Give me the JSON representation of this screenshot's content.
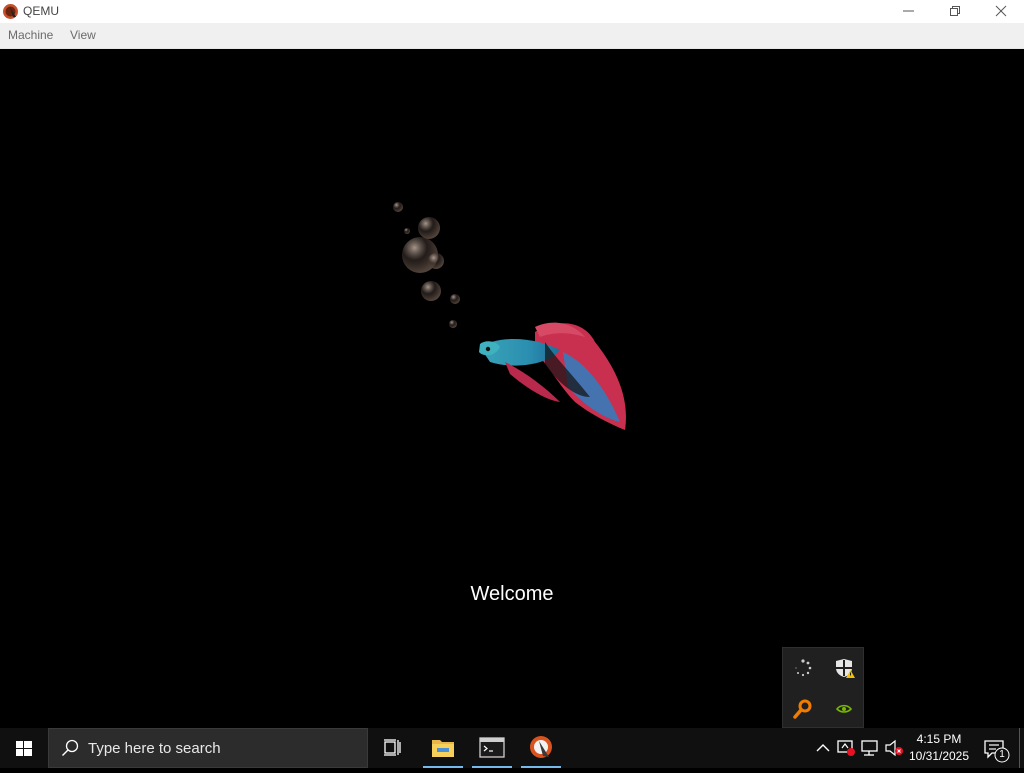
{
  "window": {
    "title": "QEMU"
  },
  "menubar": {
    "items": [
      "Machine",
      "View"
    ]
  },
  "screen": {
    "welcome_text": "Welcome"
  },
  "taskbar": {
    "search_placeholder": "Type here to search",
    "apps": [
      {
        "icon": "task-view-icon"
      },
      {
        "icon": "file-explorer-icon",
        "active": true
      },
      {
        "icon": "terminal-icon",
        "active": true
      },
      {
        "icon": "qemu-icon",
        "active": true
      }
    ],
    "tray_icons": [
      "chevron-up-icon",
      "network-alert-icon",
      "display-network-icon",
      "volume-muted-icon"
    ],
    "clock": {
      "time": "4:15 PM",
      "date": "10/31/2025"
    },
    "notification_count": "1"
  },
  "tray_overflow": {
    "icons": [
      "loading-icon",
      "security-warning-icon",
      "magnifier-icon",
      "nvidia-icon"
    ]
  },
  "colors": {
    "accent_underline": "#76b9ed",
    "taskbar_bg": "#101010",
    "display_bg": "#000000"
  }
}
